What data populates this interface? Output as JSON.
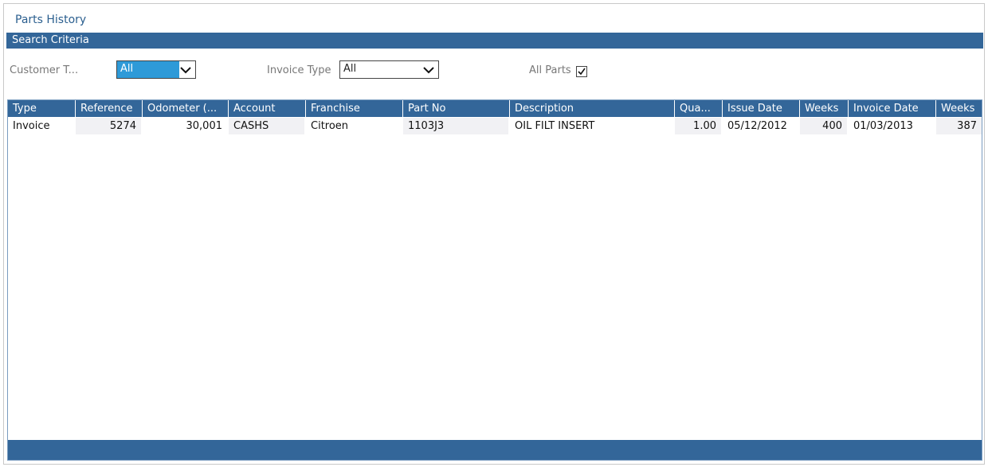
{
  "page": {
    "title": "Parts History"
  },
  "criteria": {
    "section_title": "Search Criteria",
    "customer_type": {
      "label": "Customer T...",
      "value": "All"
    },
    "invoice_type": {
      "label": "Invoice Type",
      "value": "All"
    },
    "all_parts": {
      "label": "All Parts",
      "checked": true
    }
  },
  "table": {
    "columns": [
      "Type",
      "Reference",
      "Odometer (...",
      "Account",
      "Franchise",
      "Part No",
      "Description",
      "Qua...",
      "Issue Date",
      "Weeks",
      "Invoice Date",
      "Weeks"
    ],
    "rows": [
      [
        "Invoice",
        "5274",
        "30,001",
        "CASHS",
        "Citroen",
        "1103J3",
        "OIL FILT INSERT",
        "1.00",
        "05/12/2012",
        "400",
        "01/03/2013",
        "387"
      ]
    ]
  },
  "colors": {
    "header_bar": "#336699",
    "selected": "#2e9ad8"
  }
}
